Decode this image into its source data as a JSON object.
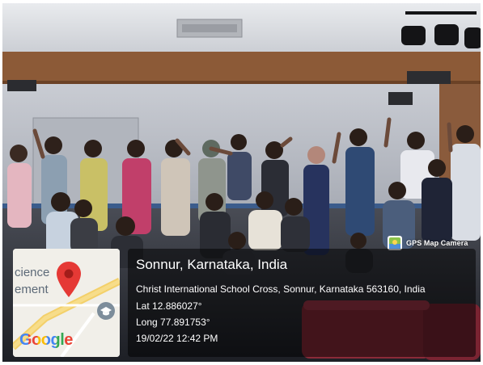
{
  "photo": {
    "subject": "group-activity-in-auditorium"
  },
  "badge": {
    "label": "GPS Map Camera",
    "icon": "gps-map-camera-logo-icon"
  },
  "map": {
    "label_line1": "cience",
    "label_line2": "ement",
    "brand": "Google",
    "pin_icon": "location-pin-icon",
    "poi_icon": "graduation-cap-icon",
    "colors": {
      "pin": "#e53935",
      "land": "#f1efe9",
      "road": "#f3d06a",
      "poi": "#7d8d9b"
    }
  },
  "location": {
    "title": "Sonnur, Karnataka, India",
    "address": "Christ International School Cross, Sonnur, Karnataka 563160, India",
    "lat": "Lat 12.886027°",
    "long": "Long 77.891753°",
    "datetime": "19/02/22 12:42 PM"
  }
}
